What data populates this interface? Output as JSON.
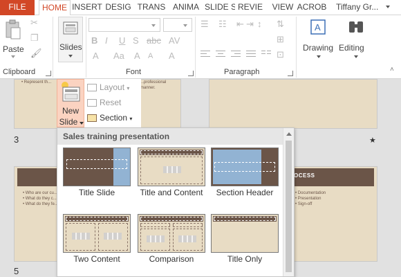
{
  "tabs": [
    {
      "label": "FILE",
      "active": false
    },
    {
      "label": "HOME",
      "active": true
    },
    {
      "label": "INSERT",
      "active": false
    },
    {
      "label": "DESIG",
      "active": false
    },
    {
      "label": "TRANS",
      "active": false
    },
    {
      "label": "ANIMA",
      "active": false
    },
    {
      "label": "SLIDE S",
      "active": false
    },
    {
      "label": "REVIE",
      "active": false
    },
    {
      "label": "VIEW",
      "active": false
    },
    {
      "label": "ACROB",
      "active": false
    }
  ],
  "user": {
    "name": "Tiffany Gr..."
  },
  "ribbon": {
    "paste_label": "Paste",
    "slides_label": "Slides",
    "drawing_label": "Drawing",
    "editing_label": "Editing",
    "groups": {
      "clipboard": "Clipboard",
      "font": "Font",
      "paragraph": "Paragraph"
    }
  },
  "new_slide": {
    "label_line1": "New",
    "label_line2": "Slide",
    "menu": {
      "layout": "Layout",
      "reset": "Reset",
      "section": "Section"
    }
  },
  "gallery": {
    "title": "Sales training presentation",
    "layouts": [
      {
        "name": "Title Slide"
      },
      {
        "name": "Title and Content"
      },
      {
        "name": "Section Header"
      },
      {
        "name": "Two Content"
      },
      {
        "name": "Comparison"
      },
      {
        "name": "Title Only"
      }
    ]
  },
  "slides": [
    {
      "number": "3"
    },
    {
      "number": "5"
    }
  ],
  "slide_text": {
    "top_left_bullet": "• Represent th...",
    "top_center_line": "...professional manner.",
    "bottom_left_bullets": [
      "• Who are our cu...",
      "• What do they c...",
      "• What do they fe..."
    ],
    "bottom_right_title": "OCESS",
    "bottom_right_bullets": [
      "• Documentation",
      "• Presentation",
      "• Sign-off"
    ]
  },
  "colors": {
    "accent": "#d24726",
    "slide_brown": "#6b5548",
    "slide_beige": "#e8dcc4",
    "section_blue": "#92b3d3"
  }
}
